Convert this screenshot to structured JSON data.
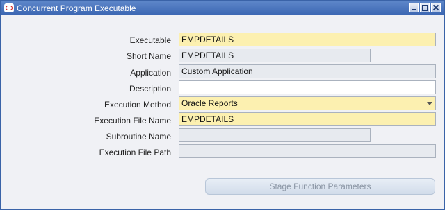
{
  "window": {
    "title": "Concurrent Program Executable",
    "icons": [
      "oracle-logo-icon",
      "minimize-icon",
      "maximize-icon",
      "close-icon"
    ]
  },
  "form": {
    "executable": {
      "label": "Executable",
      "value": "EMPDETAILS"
    },
    "short_name": {
      "label": "Short Name",
      "value": "EMPDETAILS"
    },
    "application": {
      "label": "Application",
      "value": "Custom Application"
    },
    "description": {
      "label": "Description",
      "value": ""
    },
    "execution_method": {
      "label": "Execution Method",
      "value": "Oracle Reports"
    },
    "execution_file_name": {
      "label": "Execution File Name",
      "value": "EMPDETAILS"
    },
    "subroutine_name": {
      "label": "Subroutine Name",
      "value": ""
    },
    "execution_file_path": {
      "label": "Execution File Path",
      "value": ""
    }
  },
  "buttons": {
    "stage_function_parameters": "Stage Function Parameters"
  },
  "colors": {
    "title_bar": "#3b66b2",
    "required_field": "#fcf0b0",
    "disabled_field": "#e7eaef",
    "window_bg": "#f0f1f5"
  }
}
